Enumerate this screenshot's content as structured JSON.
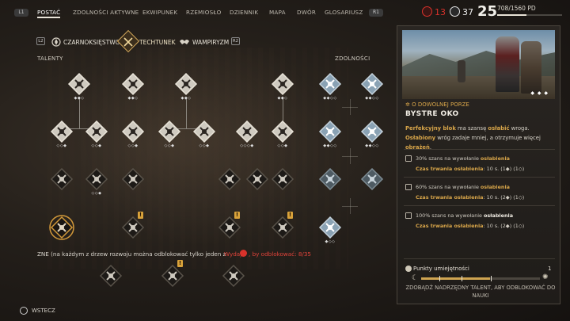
{
  "nav": {
    "left_key": "L1",
    "right_key": "R1",
    "tabs": [
      "POSTAĆ",
      "ZDOLNOŚCI AKTYWNE",
      "EKWIPUNEK",
      "RZEMIOSŁO",
      "DZIENNIK",
      "MAPA",
      "DWÓR",
      "GLOSARIUSZ"
    ],
    "active_tab": "POSTAĆ"
  },
  "resources": {
    "red_value": "13",
    "white_value": "37",
    "level": "25",
    "xp_text": "708/1560 PD",
    "xp_progress": 0.454,
    "colors": {
      "red": "#d9322b",
      "white": "#eeeeee"
    }
  },
  "subtree": {
    "left_key": "L2",
    "right_key": "R2",
    "tabs": [
      "CZARNOKSIĘSTWO",
      "TECHTUNEK",
      "WAMPIRYZM"
    ],
    "active": "TECHTUNEK"
  },
  "sections": {
    "talents": "TALENTY",
    "abilities": "ZDOLNOŚCI"
  },
  "talent_nodes": [
    {
      "icon": "shield-burst-icon",
      "pips": "◆◆◇",
      "state": "owned"
    },
    {
      "icon": "sword-slash-icon",
      "pips": "◆◆◇",
      "state": "owned"
    },
    {
      "icon": "muscle-arm-icon",
      "pips": "◆◆◇",
      "state": "owned"
    },
    {
      "icon": "fist-icon",
      "pips": "◆◆◇",
      "state": "owned"
    },
    {
      "icon": "wolf-icon",
      "pips": "◇◇◆",
      "state": "owned"
    },
    {
      "icon": "blades-cross-icon",
      "pips": "◇◇◆",
      "state": "owned"
    },
    {
      "icon": "dagger-hand-icon",
      "pips": "◇◇◆",
      "state": "owned"
    },
    {
      "icon": "spin-attack-icon",
      "pips": "◇◇◆",
      "state": "owned"
    },
    {
      "icon": "horse-icon",
      "pips": "◇◇◆",
      "state": "owned"
    },
    {
      "icon": "explosion-icon",
      "pips": "◇◇◇◆",
      "state": "owned"
    },
    {
      "icon": "grapple-icon",
      "pips": "◇◇◆",
      "state": "owned"
    },
    {
      "icon": "beast-icon",
      "pips": "◇◇◆",
      "state": "owned"
    }
  ],
  "ability_nodes": [
    {
      "icon": "shield-bash-icon",
      "pips": "◆◆◇◇"
    },
    {
      "icon": "swirl-strike-icon",
      "pips": "◆◆◇◇"
    },
    {
      "icon": "dash-icon",
      "pips": "◆◆◇◇"
    },
    {
      "icon": "sprint-icon",
      "pips": "◆◆◇◇"
    },
    {
      "icon": "rune-circle-icon",
      "pips": ""
    },
    {
      "icon": "rune-ring-icon",
      "pips": ""
    },
    {
      "icon": "eye-strike-icon",
      "pips": "◆◇◇"
    }
  ],
  "bottom": {
    "note": "ZNE (na każdym z drzew rozwoju można odblokować tylko jeden z",
    "warning": "Wydaj",
    "warning2": ", by odblokować: 8/35",
    "back_label": "WSTECZ"
  },
  "detail": {
    "condition": "O DOWOLNEJ PORZE",
    "title": "BYSTRE OKO",
    "desc_part1": "Perfekcyjny blok",
    "desc_part2": " ma szansę ",
    "desc_part3": "osłabić",
    "desc_part4": " wroga.",
    "desc_part5": "Osłabiony",
    "desc_part6": " wróg zadaje mniej, a otrzymuje więcej ",
    "desc_part7": "obrażeń",
    "desc_part8": ".",
    "image_dots": "◆ ◆ ◆",
    "levels": [
      {
        "chance_pre": "30% szans na wywołanie ",
        "chance_word": "osłabienia",
        "duration_label": "Czas trwania osłabienia",
        "duration_value": ": 10 s. (1",
        "duration_rest": ") (1",
        "close": ")"
      },
      {
        "chance_pre": "60% szans na wywołanie ",
        "chance_word": "osłabienia",
        "duration_label": "Czas trwania osłabienia",
        "duration_value": ": 10 s. (2",
        "duration_rest": ") (1",
        "close": ")"
      },
      {
        "chance_pre": "100% szans na wywołanie ",
        "chance_word": "osłabienia",
        "duration_label": "Czas trwania osłabienia",
        "duration_value": ": 10 s. (2",
        "duration_rest": ") (1",
        "close": ")"
      }
    ],
    "skill_points_label": "Punkty umiejętności",
    "skill_points_value": "1",
    "skill_points_progress": 0.58,
    "unlock_note": "ZDOBĄDŹ NADRZĘDNY TALENT, ABY ODBLOKOWAĆ DO NAUKI"
  }
}
